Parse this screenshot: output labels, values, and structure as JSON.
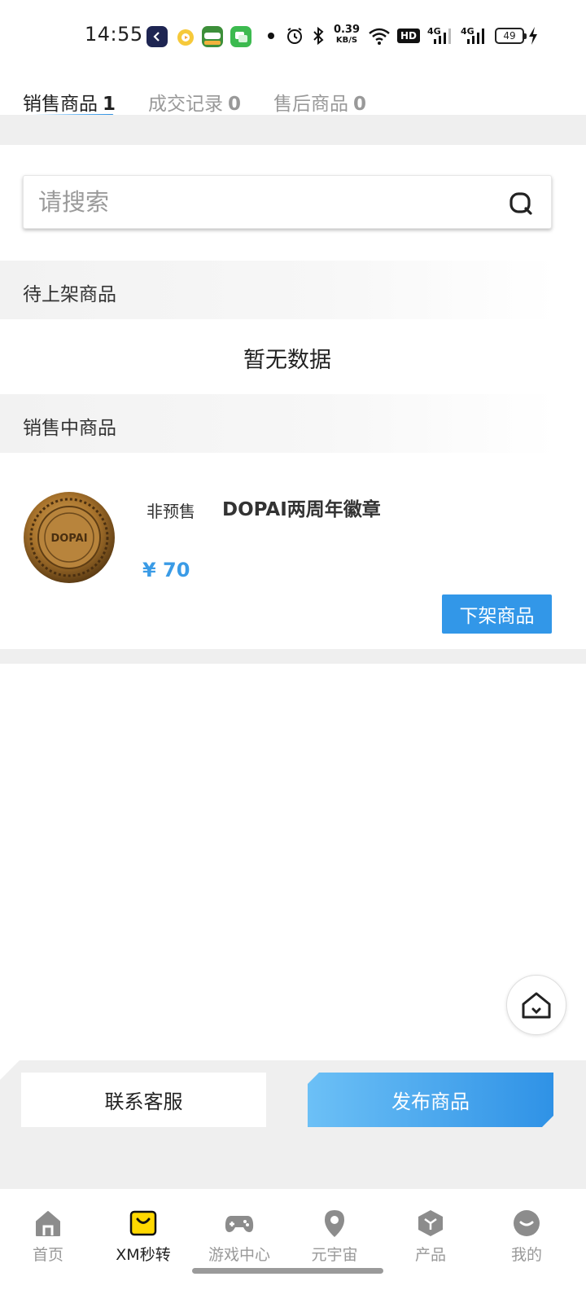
{
  "status_bar": {
    "time": "14:55",
    "net_speed_value": "0.39",
    "net_speed_unit": "KB/S",
    "hd_label": "HD",
    "signal_1": "4G",
    "signal_2": "4G",
    "battery": "49"
  },
  "tabs": [
    {
      "label": "销售商品",
      "count": "1",
      "active": true
    },
    {
      "label": "成交记录",
      "count": "0",
      "active": false
    },
    {
      "label": "售后商品",
      "count": "0",
      "active": false
    }
  ],
  "search": {
    "placeholder": "请搜索",
    "value": ""
  },
  "sections": {
    "pending": {
      "title": "待上架商品",
      "empty_text": "暂无数据"
    },
    "on_sale": {
      "title": "销售中商品"
    }
  },
  "product": {
    "presale_tag": "非预售",
    "name": "DOPAI两周年徽章",
    "image_text": "DOPAI",
    "price": "¥ 70",
    "delist_label": "下架商品"
  },
  "actions": {
    "contact_label": "联系客服",
    "publish_label": "发布商品"
  },
  "bottom_nav": [
    {
      "label": "首页",
      "icon": "home-icon"
    },
    {
      "label": "XM秒转",
      "icon": "shopping-bag-icon",
      "active": true
    },
    {
      "label": "游戏中心",
      "icon": "gamepad-icon"
    },
    {
      "label": "元宇宙",
      "icon": "location-pin-icon"
    },
    {
      "label": "产品",
      "icon": "cube-icon"
    },
    {
      "label": "我的",
      "icon": "profile-icon"
    }
  ],
  "colors": {
    "accent": "#3297e8",
    "price": "#3a9be6",
    "active_nav": "#ffd800"
  }
}
